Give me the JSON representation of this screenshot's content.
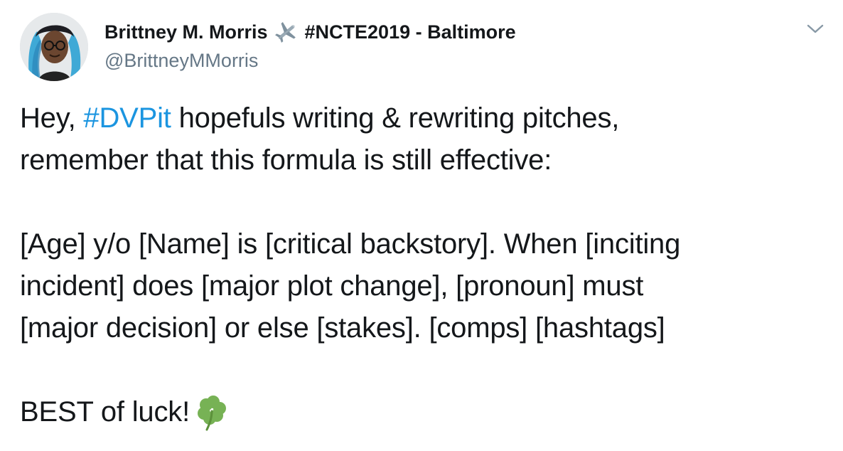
{
  "author": {
    "display_name": "Brittney M. Morris",
    "name_suffix": "#NCTE2019 - Baltimore",
    "handle": "@BrittneyMMorris",
    "name_icon": "airplane-icon",
    "avatar_icon": "avatar"
  },
  "menu": {
    "icon": "chevron-down-icon"
  },
  "tweet": {
    "line1_pre": "Hey, ",
    "hashtag": "#DVPit",
    "line1_post": " hopefuls writing & rewriting pitches,",
    "line2": "remember that this formula is still effective:",
    "formula_lines": [
      "[Age] y/o [Name] is [critical backstory]. When [inciting",
      "incident] does [major plot change], [pronoun] must",
      "[major decision] or else [stakes]. [comps] [hashtags]"
    ],
    "closing": "BEST of luck!",
    "closing_emoji": "four-leaf-clover-icon"
  },
  "colors": {
    "link": "#1b95e0",
    "text": "#14171a",
    "secondary": "#657786",
    "clover": "#77b255"
  }
}
